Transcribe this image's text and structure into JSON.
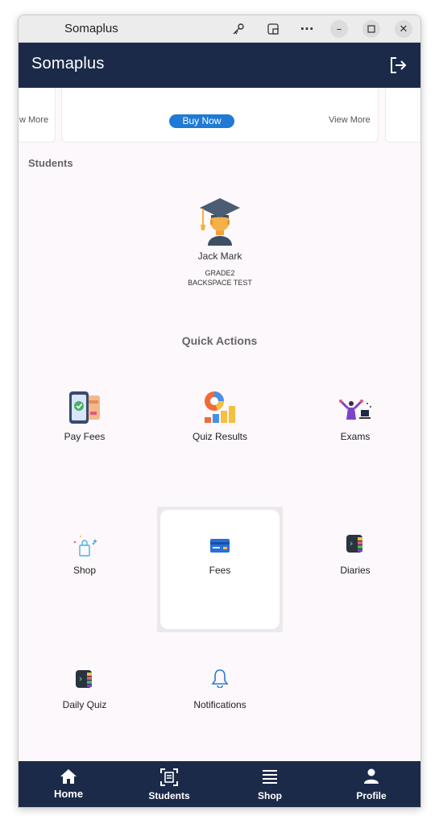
{
  "window": {
    "title": "Somaplus"
  },
  "appbar": {
    "title": "Somaplus"
  },
  "banner": {
    "left_link": "w More",
    "buy_now": "Buy Now",
    "right_link": "View More"
  },
  "students_section": {
    "title": "Students"
  },
  "student": {
    "name": "Jack Mark",
    "grade": "GRADE2",
    "school": "BACKSPACE TEST"
  },
  "quick_actions": {
    "title": "Quick Actions",
    "items": [
      {
        "label": "Pay Fees",
        "icon": "pay-fees-icon"
      },
      {
        "label": "Quiz Results",
        "icon": "quiz-results-icon"
      },
      {
        "label": "Exams",
        "icon": "exams-icon"
      },
      {
        "label": "Shop",
        "icon": "shop-icon"
      },
      {
        "label": "Fees",
        "icon": "fees-icon"
      },
      {
        "label": "Diaries",
        "icon": "diaries-icon"
      },
      {
        "label": "Daily Quiz",
        "icon": "daily-quiz-icon"
      },
      {
        "label": "Notifications",
        "icon": "bell-icon"
      }
    ]
  },
  "bottom_nav": [
    {
      "label": "Home",
      "icon": "home-icon"
    },
    {
      "label": "Students",
      "icon": "students-icon"
    },
    {
      "label": "Shop",
      "icon": "list-icon"
    },
    {
      "label": "Profile",
      "icon": "person-icon"
    }
  ],
  "colors": {
    "appbar": "#1c2a49",
    "accent": "#1f7ad6",
    "background": "#fdf8fb"
  }
}
